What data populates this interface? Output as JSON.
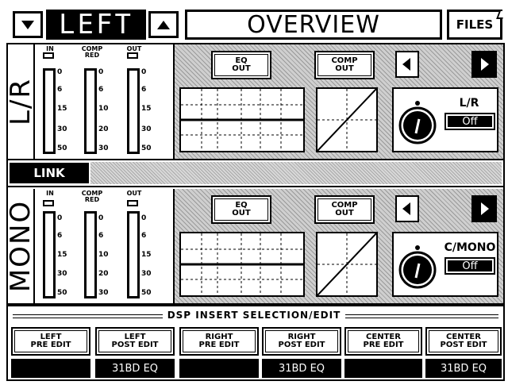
{
  "header": {
    "down_icon": "triangle-down-icon",
    "channel": "LEFT",
    "up_icon": "triangle-up-icon",
    "title": "OVERVIEW",
    "files_label": "FILES"
  },
  "channels": [
    {
      "label": "L/R",
      "meters": [
        {
          "title": "IN",
          "scale": [
            "0",
            "6",
            "15",
            "30",
            "50"
          ]
        },
        {
          "title": "COMP\nRED",
          "scale": [
            "0",
            "6",
            "10",
            "20",
            "30"
          ]
        },
        {
          "title": "OUT",
          "scale": [
            "0",
            "6",
            "15",
            "30",
            "50"
          ]
        }
      ],
      "eq_label": "EQ\nOUT",
      "comp_label": "COMP\nOUT",
      "knob_label": "L/R",
      "knob_value": "Off"
    },
    {
      "label": "MONO",
      "meters": [
        {
          "title": "IN",
          "scale": [
            "0",
            "6",
            "15",
            "30",
            "50"
          ]
        },
        {
          "title": "COMP\nRED",
          "scale": [
            "0",
            "6",
            "10",
            "20",
            "30"
          ]
        },
        {
          "title": "OUT",
          "scale": [
            "0",
            "6",
            "15",
            "30",
            "50"
          ]
        }
      ],
      "eq_label": "EQ\nOUT",
      "comp_label": "COMP\nOUT",
      "knob_label": "C/MONO",
      "knob_value": "Off"
    }
  ],
  "link_label": "LINK",
  "dsp": {
    "title": "DSP INSERT SELECTION/EDIT",
    "slots": [
      {
        "label": "LEFT\nPRE EDIT",
        "value": ""
      },
      {
        "label": "LEFT\nPOST EDIT",
        "value": "31BD EQ"
      },
      {
        "label": "RIGHT\nPRE EDIT",
        "value": ""
      },
      {
        "label": "RIGHT\nPOST EDIT",
        "value": "31BD EQ"
      },
      {
        "label": "CENTER\nPRE EDIT",
        "value": ""
      },
      {
        "label": "CENTER\nPOST EDIT",
        "value": "31BD EQ"
      }
    ]
  },
  "colors": {
    "ink": "#000000",
    "paper": "#ffffff",
    "hatch": "#cfcfcf"
  }
}
